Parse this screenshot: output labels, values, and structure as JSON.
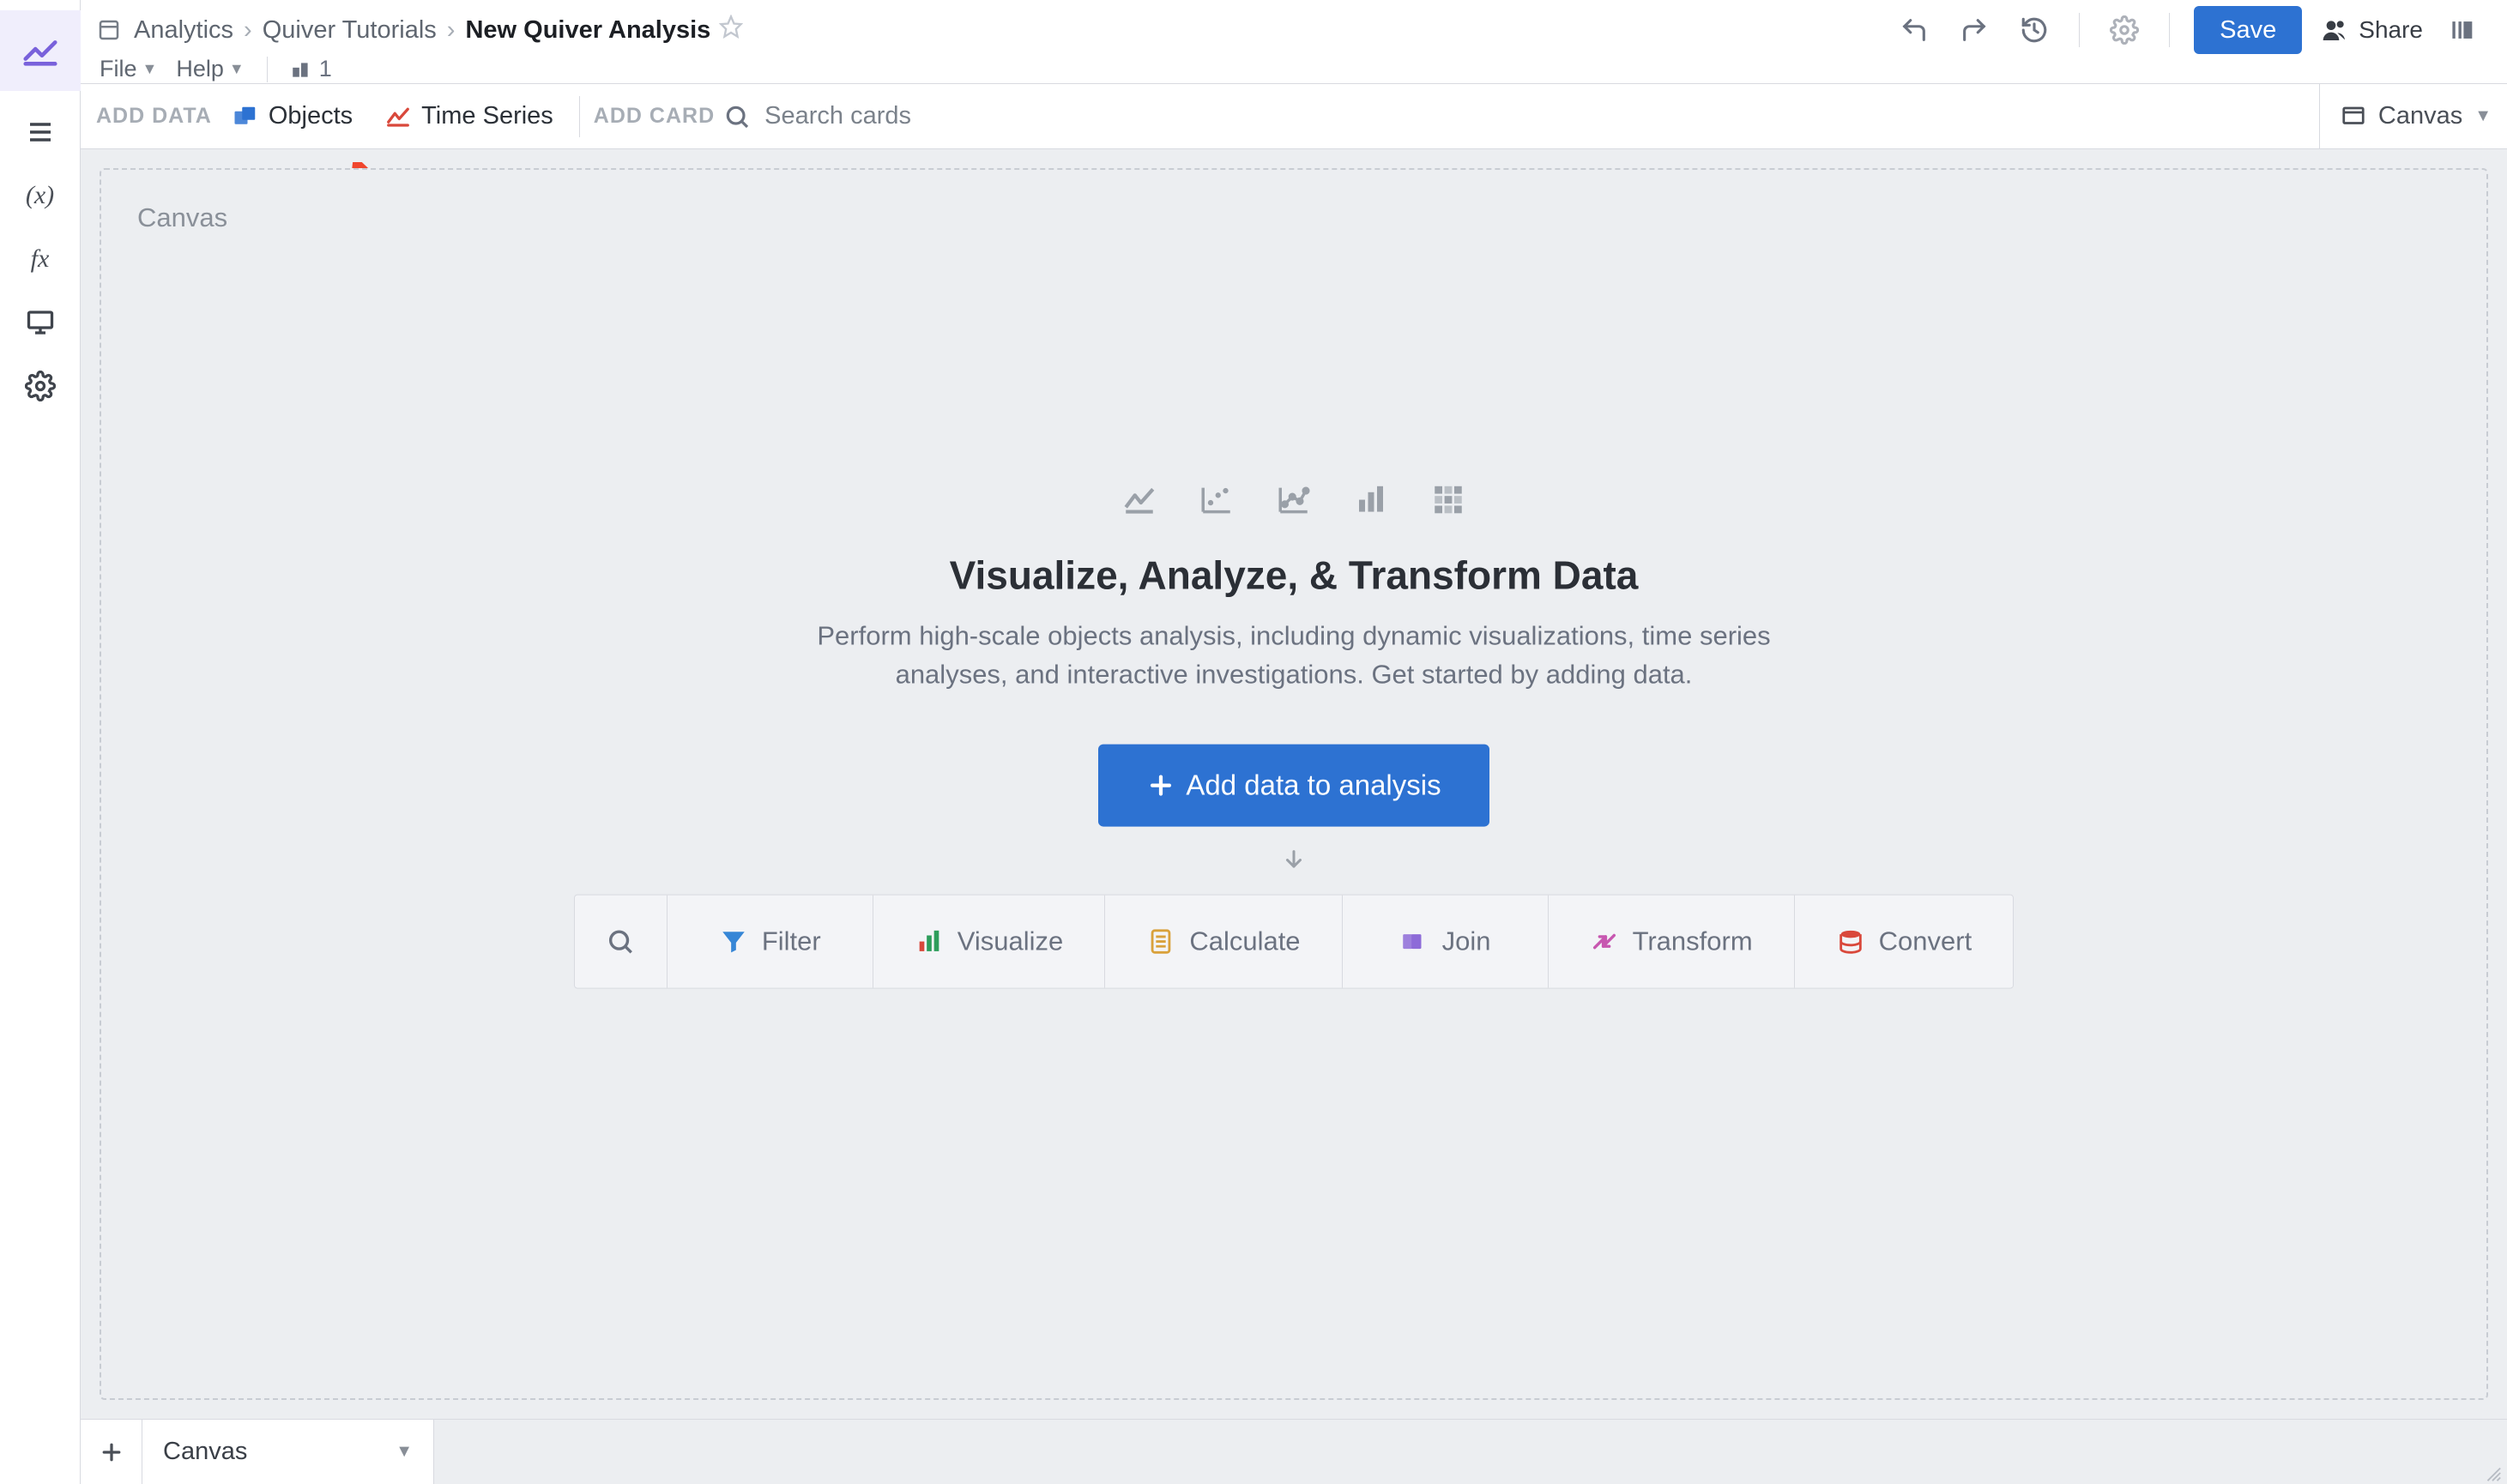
{
  "breadcrumb": {
    "root": "Analytics",
    "parent": "Quiver Tutorials",
    "current": "New Quiver Analysis"
  },
  "menus": {
    "file": "File",
    "help": "Help",
    "presence_count": "1"
  },
  "header_actions": {
    "save": "Save",
    "share": "Share",
    "icons": {
      "undo": "undo-icon",
      "redo": "redo-icon",
      "history": "history-icon",
      "settings": "gear-icon",
      "panel": "panel-right-icon"
    }
  },
  "toolbar": {
    "add_data_label": "ADD DATA",
    "objects": "Objects",
    "time_series": "Time Series",
    "add_card_label": "ADD CARD",
    "search_placeholder": "Search cards",
    "view_mode": "Canvas"
  },
  "canvas": {
    "title": "Canvas",
    "empty_heading": "Visualize, Analyze, & Transform Data",
    "empty_subtext": "Perform high-scale objects analysis, including dynamic visualizations, time series analyses, and interactive investigations. Get started by adding data.",
    "cta_label": "Add data to analysis",
    "actions": {
      "search": "",
      "filter": "Filter",
      "visualize": "Visualize",
      "calculate": "Calculate",
      "join": "Join",
      "transform": "Transform",
      "convert": "Convert"
    },
    "chart_icons": [
      "line-chart-icon",
      "scatter-icon",
      "scatter-line-icon",
      "bar-chart-icon",
      "heatmap-icon"
    ]
  },
  "bottom_tabs": {
    "active": "Canvas"
  },
  "colors": {
    "primary": "#2d72d2",
    "accent_red": "#d9483b",
    "accent_purple": "#7961db",
    "annotation_arrow": "#f0462d"
  },
  "annotation": {
    "type": "arrow",
    "target": "time-series-button"
  }
}
